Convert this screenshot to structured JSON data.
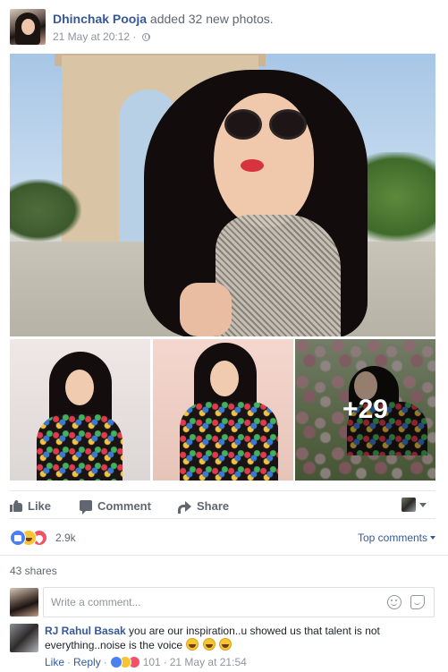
{
  "post": {
    "author": "Dhinchak Pooja",
    "action": "added 32 new photos.",
    "timestamp": "21 May at 20:12",
    "separator": "·",
    "privacy_icon": "globe-icon"
  },
  "photos": {
    "more_count": "+29"
  },
  "actions": {
    "like": "Like",
    "comment": "Comment",
    "share": "Share"
  },
  "reactions": {
    "count": "2.9k",
    "types": [
      "like",
      "haha",
      "love"
    ],
    "top_comments": "Top comments"
  },
  "shares": "43 shares",
  "composer": {
    "placeholder": "Write a comment..."
  },
  "comment": {
    "author": "RJ Rahul Basak",
    "text": "you are our inspiration..u showed us that talent is not everything..noise is the voice",
    "like": "Like",
    "dot1": "·",
    "reply": "Reply",
    "dot2": "·",
    "reaction_count": "101",
    "dot3": "·",
    "time": "21 May at 21:54"
  },
  "colors": {
    "link": "#365899",
    "muted": "#90949c",
    "like_blue": "#4a80f0",
    "haha_yellow": "#f7c433",
    "love_red": "#f25268"
  }
}
